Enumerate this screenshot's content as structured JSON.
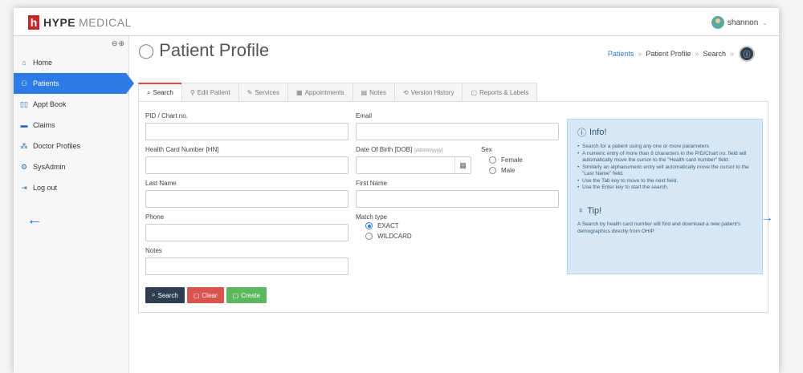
{
  "app": {
    "brand_letter": "h",
    "brand_bold": "HYPE",
    "brand_light": "MEDICAL"
  },
  "user": {
    "name": "shannon"
  },
  "sidebar": {
    "collapse_label": "⊖⊕",
    "items": [
      {
        "label": "Home",
        "icon": "home-icon",
        "glyph": "⌂"
      },
      {
        "label": "Patients",
        "icon": "patients-icon",
        "glyph": "👥"
      },
      {
        "label": "Appt Book",
        "icon": "book-icon",
        "glyph": "📖"
      },
      {
        "label": "Claims",
        "icon": "briefcase-icon",
        "glyph": "▬"
      },
      {
        "label": "Doctor Profiles",
        "icon": "sitemap-icon",
        "glyph": "⁂"
      },
      {
        "label": "SysAdmin",
        "icon": "gear-icon",
        "glyph": "⚙"
      },
      {
        "label": "Log out",
        "icon": "logout-icon",
        "glyph": "⇥"
      }
    ],
    "active_index": 1
  },
  "header": {
    "title": "Patient Profile",
    "breadcrumb": [
      "Patients",
      "Patient Profile",
      "Search"
    ]
  },
  "tabs": [
    {
      "label": "Search",
      "glyph": "🔍"
    },
    {
      "label": "Edit Patient",
      "glyph": "👤"
    },
    {
      "label": "Services",
      "glyph": "✎"
    },
    {
      "label": "Appointments",
      "glyph": "▦"
    },
    {
      "label": "Notes",
      "glyph": "▤"
    },
    {
      "label": "Version History",
      "glyph": "⟲"
    },
    {
      "label": "Reports & Labels",
      "glyph": "▢"
    }
  ],
  "form": {
    "pid_label": "PID / Chart no.",
    "email_label": "Email",
    "hcn_label": "Health Card Number [HN]",
    "dob_label": "Date Of Birth [DOB]",
    "dob_hint": "[dd/mm/yyyy]",
    "sex_label": "Sex",
    "sex_options": [
      "Female",
      "Male"
    ],
    "last_name_label": "Last Name",
    "first_name_label": "First Name",
    "phone_label": "Phone",
    "match_label": "Match type",
    "match_options": [
      "EXACT",
      "WILDCARD"
    ],
    "match_selected": "EXACT",
    "notes_label": "Notes"
  },
  "buttons": {
    "search": "Search",
    "clear": "Clear",
    "create": "Create"
  },
  "info": {
    "title": "Info!",
    "items": [
      "Search for a patient using any one or more parameters",
      "A numeric entry of more than 8 characters in the PID/Chart no. field will automatically move the cursor to the \"Health card number\" field.",
      "Similarly an alphanumeric entry will automatically move the cursor to the \"Last Name\" field.",
      "Use the Tab key to move to the next field.",
      "Use the Enter key to start the search."
    ],
    "tip_title": "Tip!",
    "tip_text": "A Search by health card number will find and download a new patient's demographics directly from OHIP"
  },
  "colors": {
    "accent": "#2d7be5",
    "danger": "#d9534f",
    "success": "#5cb85c",
    "dark": "#2d3e50",
    "brand_red": "#c62828"
  }
}
